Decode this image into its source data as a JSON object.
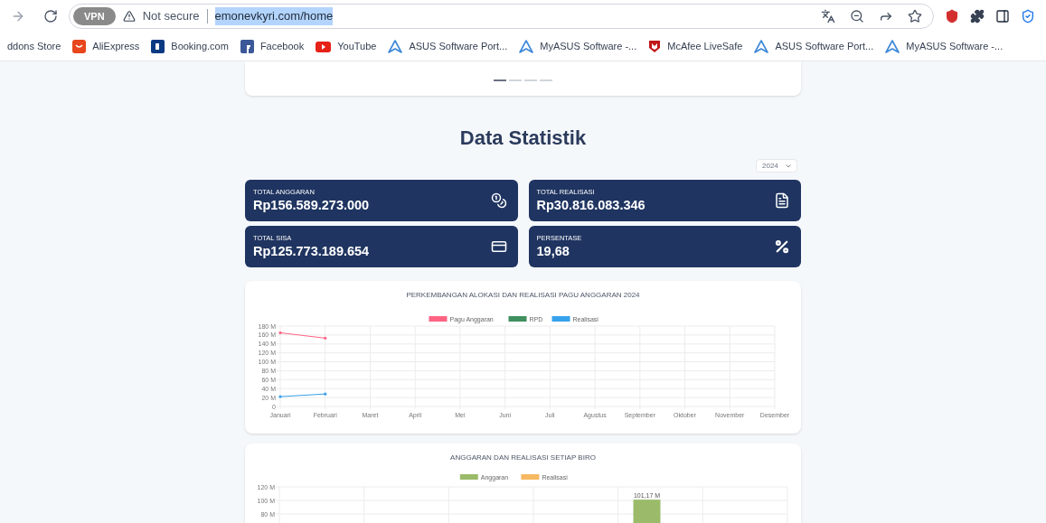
{
  "browser": {
    "vpn_badge": "VPN",
    "security": "Not secure",
    "url": "emonevkyri.com/home"
  },
  "bookmarks": [
    {
      "label": "ddons Store",
      "kind": "none"
    },
    {
      "label": "AliExpress",
      "kind": "smile"
    },
    {
      "label": "Booking.com",
      "kind": "square"
    },
    {
      "label": "Facebook",
      "kind": "fsquare"
    },
    {
      "label": "YouTube",
      "kind": "play"
    },
    {
      "label": "ASUS Software Port...",
      "kind": "triangle"
    },
    {
      "label": "MyASUS Software -...",
      "kind": "triangle"
    },
    {
      "label": "McAfee LiveSafe",
      "kind": "shield"
    },
    {
      "label": "ASUS Software Port...",
      "kind": "triangle"
    },
    {
      "label": "MyASUS Software -...",
      "kind": "triangle"
    }
  ],
  "carousel": {
    "indicators": [
      {
        "selected": true
      },
      {
        "selected": false
      },
      {
        "selected": false
      },
      {
        "selected": false
      }
    ]
  },
  "section_title": "Data Statistik",
  "year_select": {
    "value": "2024"
  },
  "stats": [
    {
      "label": "TOTAL ANGGARAN",
      "value": "Rp156.589.273.000",
      "kind": "coins"
    },
    {
      "label": "TOTAL REALISASI",
      "value": "Rp30.816.083.346",
      "kind": "file"
    },
    {
      "label": "TOTAL SISA",
      "value": "Rp125.773.189.654",
      "kind": "card"
    },
    {
      "label": "PERSENTASE",
      "value": "19,68",
      "kind": "percent"
    }
  ],
  "charts": [
    {
      "title": "PERKEMBANGAN ALOKASI DAN REALISASI PAGU ANGGARAN 2024",
      "chart_data": {
        "type": "line",
        "categories": [
          "Januari",
          "Februari",
          "Maret",
          "April",
          "Mei",
          "Juni",
          "Juli",
          "Agustus",
          "September",
          "Oktober",
          "November",
          "Desember"
        ],
        "series": [
          {
            "name": "Pagu Anggaran",
            "color": "#ff6384",
            "values": [
              165,
              153,
              null,
              null,
              null,
              null,
              null,
              null,
              null,
              null,
              null,
              null
            ]
          },
          {
            "name": "RPD",
            "color": "#3f8f5f",
            "values": [
              null,
              null,
              null,
              null,
              null,
              null,
              null,
              null,
              null,
              null,
              null,
              null
            ]
          },
          {
            "name": "Realisasi",
            "color": "#36a2eb",
            "values": [
              22,
              28,
              null,
              null,
              null,
              null,
              null,
              null,
              null,
              null,
              null,
              null
            ]
          }
        ],
        "ylim": [
          0,
          180
        ],
        "grid": true,
        "legend": true,
        "yticks": [
          {
            "value": 0,
            "label": "0"
          },
          {
            "value": 20,
            "label": "20 M"
          },
          {
            "value": 40,
            "label": "40 M"
          },
          {
            "value": 60,
            "label": "60 M"
          },
          {
            "value": 80,
            "label": "80 M"
          },
          {
            "value": 100,
            "label": "100 M"
          },
          {
            "value": 120,
            "label": "120 M"
          },
          {
            "value": 140,
            "label": "140 M"
          },
          {
            "value": 160,
            "label": "160 M"
          },
          {
            "value": 180,
            "label": "180 M"
          }
        ]
      }
    },
    {
      "title": "ANGGARAN DAN REALISASI SETIAP BIRO",
      "chart_data": {
        "type": "bar",
        "series": [
          {
            "name": "Anggaran",
            "color": "#9bbb6a",
            "values": [
              null,
              null,
              null,
              null,
              101.17,
              null
            ]
          },
          {
            "name": "Realisasi",
            "color": "#f6b860",
            "values": [
              null,
              null,
              null,
              null,
              null,
              null
            ]
          }
        ],
        "ylim": [
          80,
          120
        ],
        "grid": true,
        "legend": true,
        "yticks": [
          {
            "value": 80,
            "label": "80 M"
          },
          {
            "value": 100,
            "label": "100 M"
          },
          {
            "value": 120,
            "label": "120 M"
          }
        ],
        "value_labels": [
          null,
          null,
          null,
          null,
          "101,17 M",
          null
        ]
      }
    }
  ]
}
